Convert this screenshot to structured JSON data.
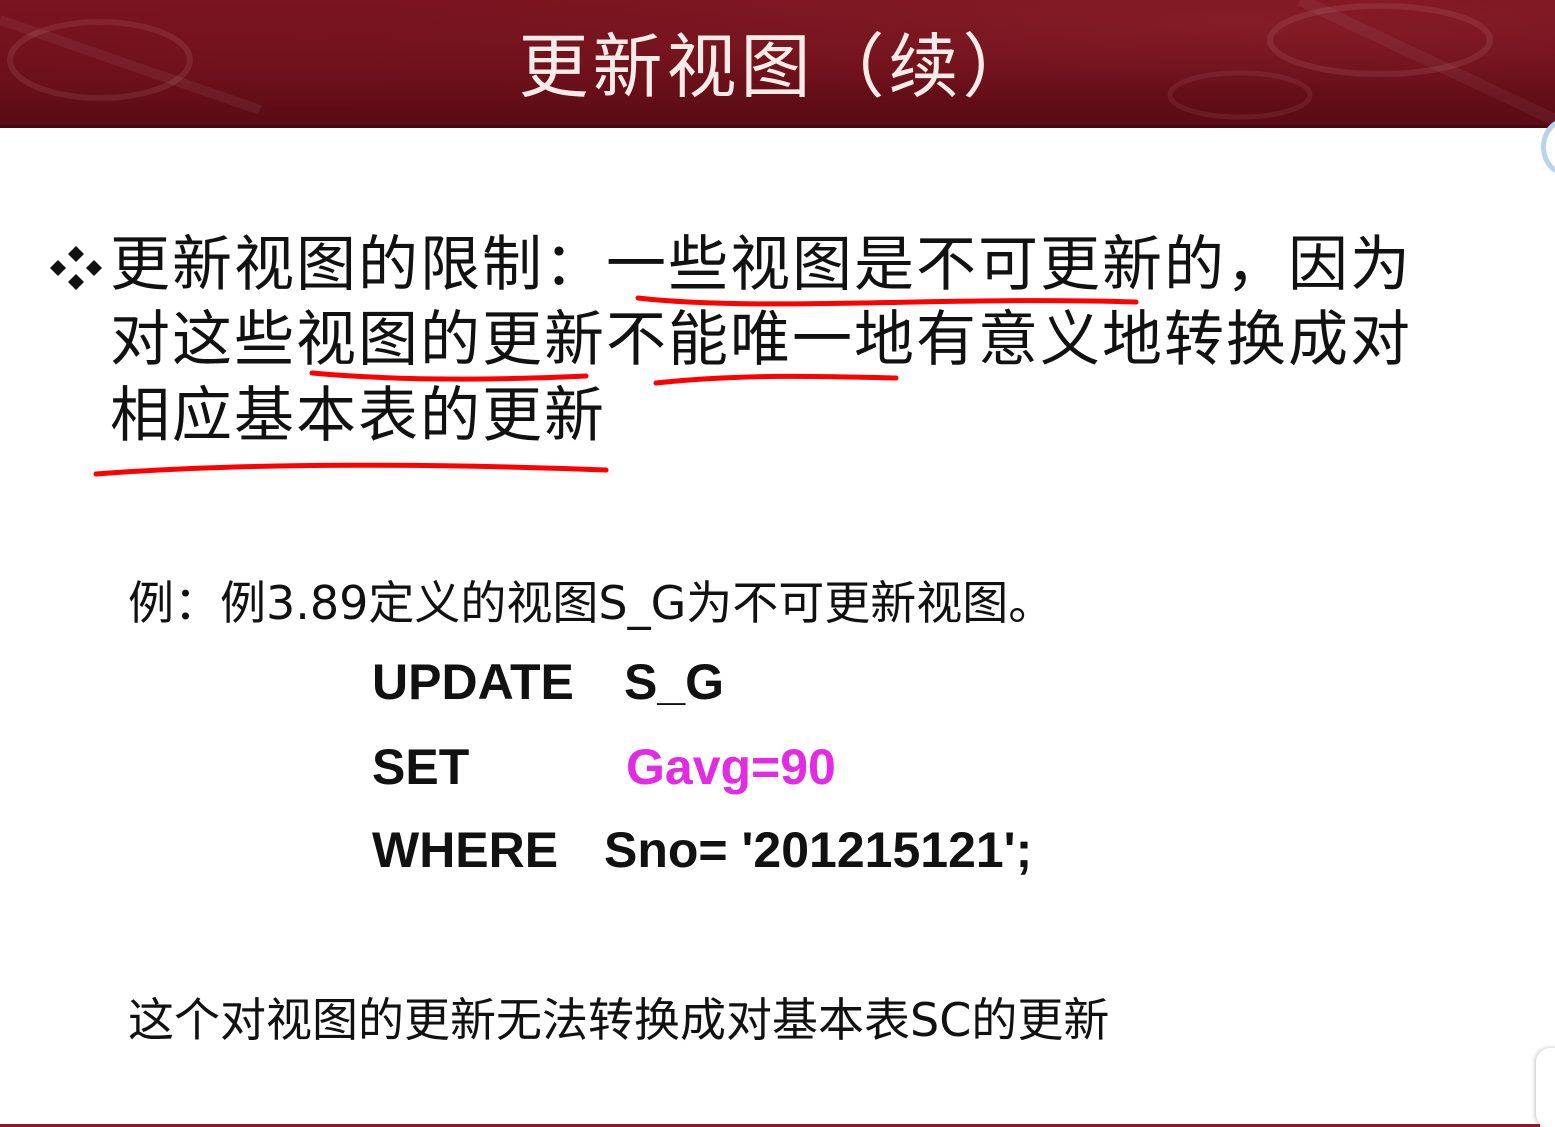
{
  "slide": {
    "title": "更新视图（续）",
    "bullet": {
      "lines": [
        "更新视图的限制：一些视图是不可更新的，因为",
        "对这些视图的更新不能唯一地有意义地转换成对",
        "相应基本表的更新"
      ]
    },
    "example": {
      "intro": "例：例3.89定义的视图S_G为不可更新视图。",
      "code": {
        "update_kw": "UPDATE",
        "update_val": "S_G",
        "set_kw": "SET",
        "set_val": "Gavg=90",
        "where_kw": "WHERE",
        "where_val": "Sno= '201215121';"
      }
    },
    "conclusion": "这个对视图的更新无法转换成对基本表SC的更新"
  },
  "colors": {
    "banner": "#6a0f1a",
    "title_text": "#f4ece6",
    "highlight_magenta": "#e22be2",
    "annotation_red": "#ff0000"
  }
}
